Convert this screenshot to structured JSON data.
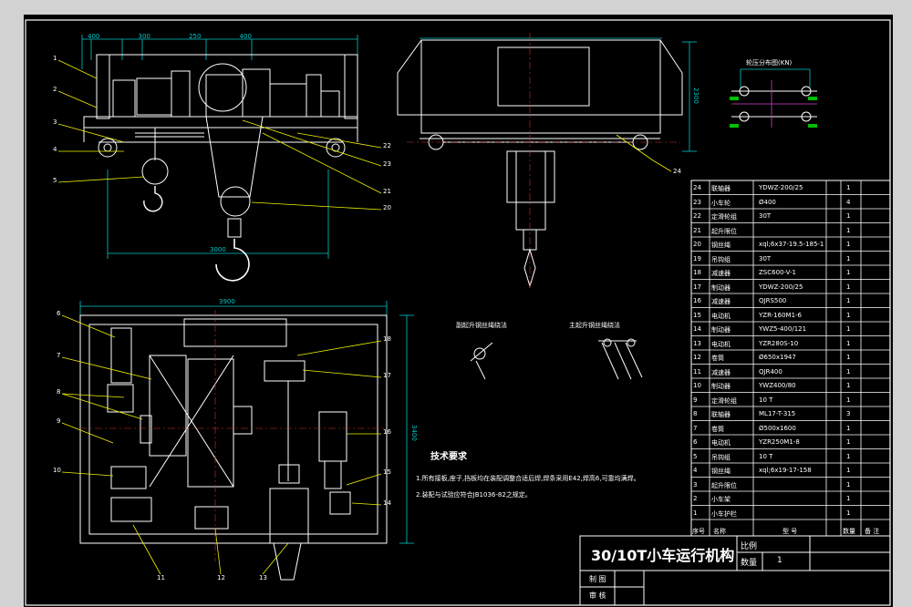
{
  "drawing": {
    "title": "30/10T小车运行机构",
    "scale_label": "比例",
    "quantity_label": "数量",
    "quantity_value": "1",
    "drawn_by_label": "制 图",
    "reviewed_by_label": "审 核"
  },
  "wheel_pressure": {
    "label": "轮压分布图(KN)"
  },
  "detail_views": {
    "aux_label": "副起升钢丝绳绕法",
    "main_label": "主起升钢丝绳绕法"
  },
  "technical_requirements": {
    "heading": "技术要求",
    "items": [
      "1.所有接板,座子,挡板均在装配调整合适后焊,焊条采用E42,焊高6,可靠均满焊。",
      "2.装配与试验应符合JB1036-82之规定。"
    ]
  },
  "parts_table": {
    "headers": {
      "no": "序号",
      "name": "名称",
      "model": "型 号",
      "qty": "数量",
      "note": "备 注"
    },
    "rows": [
      {
        "no": "24",
        "name": "联轴器",
        "model": "YDWZ-200/25",
        "qty": "1"
      },
      {
        "no": "23",
        "name": "小车轮",
        "model": "Ø400",
        "qty": "4"
      },
      {
        "no": "22",
        "name": "定滑轮组",
        "model": "30T",
        "qty": "1"
      },
      {
        "no": "21",
        "name": "起升限位",
        "model": "",
        "qty": "1"
      },
      {
        "no": "20",
        "name": "钢丝绳",
        "model": "xql;6x37-19.5-185-1",
        "qty": "1"
      },
      {
        "no": "19",
        "name": "吊钩组",
        "model": "30T",
        "qty": "1"
      },
      {
        "no": "18",
        "name": "减速器",
        "model": "ZSC600-V-1",
        "qty": "1"
      },
      {
        "no": "17",
        "name": "制动器",
        "model": "YDWZ-200/25",
        "qty": "1"
      },
      {
        "no": "16",
        "name": "减速器",
        "model": "QJRS500",
        "qty": "1"
      },
      {
        "no": "15",
        "name": "电动机",
        "model": "YZR-160M1-6",
        "qty": "1"
      },
      {
        "no": "14",
        "name": "制动器",
        "model": "YWZ5-400/121",
        "qty": "1"
      },
      {
        "no": "13",
        "name": "电动机",
        "model": "YZR280S-10",
        "qty": "1"
      },
      {
        "no": "12",
        "name": "卷筒",
        "model": "Ø650x1947",
        "qty": "1"
      },
      {
        "no": "11",
        "name": "减速器",
        "model": "QJR400",
        "qty": "1"
      },
      {
        "no": "10",
        "name": "制动器",
        "model": "YWZ400/80",
        "qty": "1"
      },
      {
        "no": "9",
        "name": "定滑轮组",
        "model": "10 T",
        "qty": "1"
      },
      {
        "no": "8",
        "name": "联轴器",
        "model": "ML17-T-315",
        "qty": "3"
      },
      {
        "no": "7",
        "name": "卷筒",
        "model": "Ø500x1600",
        "qty": "1"
      },
      {
        "no": "6",
        "name": "电动机",
        "model": "YZR250M1-8",
        "qty": "1"
      },
      {
        "no": "5",
        "name": "吊钩组",
        "model": "10 T",
        "qty": "1"
      },
      {
        "no": "4",
        "name": "钢丝绳",
        "model": "xql;6x19-17-158",
        "qty": "1"
      },
      {
        "no": "3",
        "name": "起升限位",
        "model": "",
        "qty": "1"
      },
      {
        "no": "2",
        "name": "小车架",
        "model": "",
        "qty": "1"
      },
      {
        "no": "1",
        "name": "小车护栏",
        "model": "",
        "qty": "1"
      }
    ]
  },
  "dimensions": {
    "side_top": [
      "400",
      "300",
      "250",
      "400"
    ],
    "side_span": "3000",
    "plan_width": "3900",
    "plan_height": "3400",
    "end_height": "2300"
  },
  "leaders": {
    "side_left": [
      "1",
      "2",
      "3",
      "4",
      "5"
    ],
    "side_right": [
      "22",
      "23",
      "21",
      "20"
    ],
    "end_view": [
      "24"
    ],
    "plan_left": [
      "6",
      "7",
      "8",
      "9",
      "10"
    ],
    "plan_right": [
      "18",
      "17",
      "16",
      "15",
      "14"
    ],
    "plan_bottom": [
      "11",
      "12",
      "13"
    ]
  },
  "colors": {
    "background": "#000000",
    "border": "#ffffff",
    "outline": "#ffffff",
    "dimension": "#00c8c8",
    "leader": "#f0f000",
    "centerline": "#d03030",
    "hidden": "#d040d0",
    "text": "#ffffff",
    "pressure": "#00c000"
  }
}
